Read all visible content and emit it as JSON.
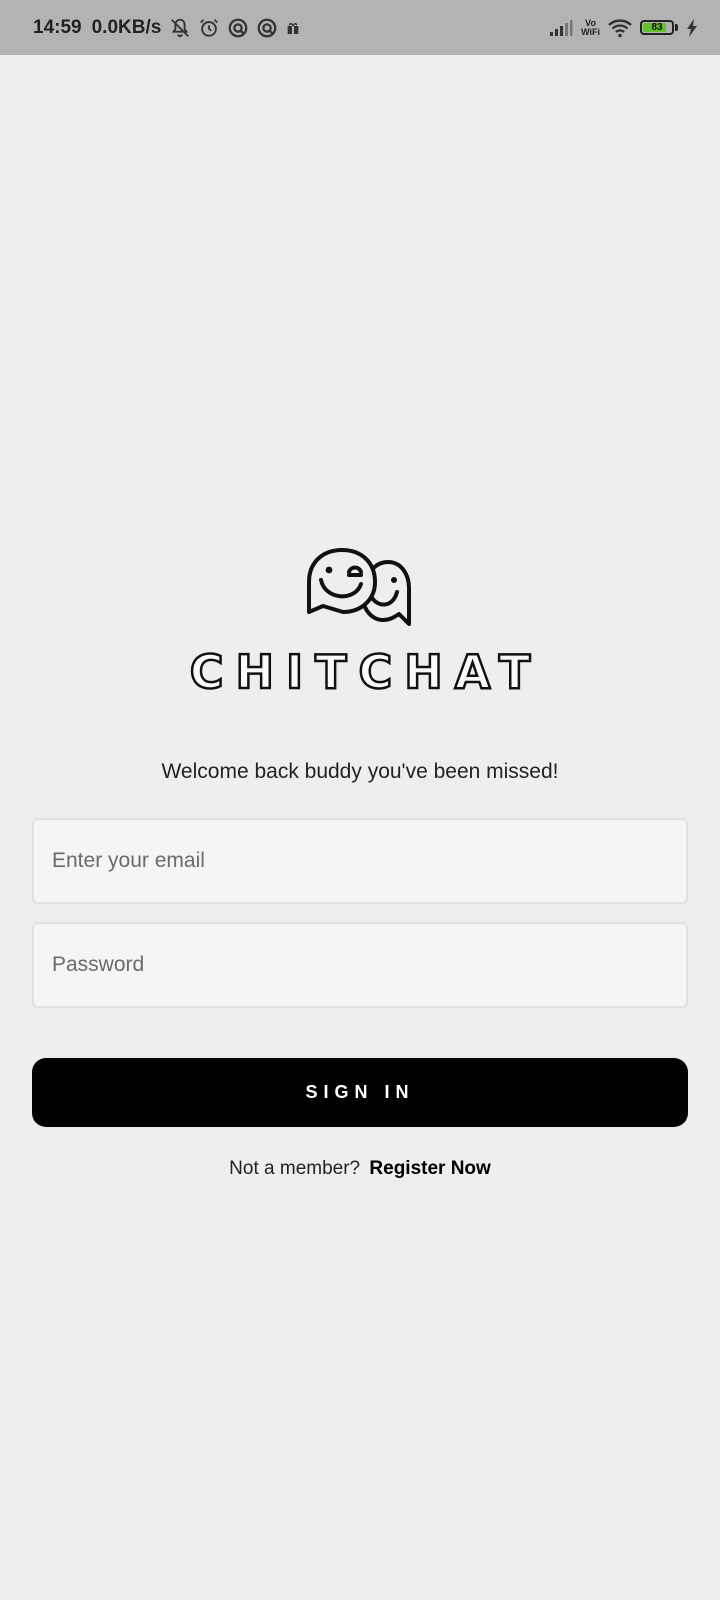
{
  "status_bar": {
    "time": "14:59",
    "net_speed": "0.0KB/s",
    "left_icons": [
      "mute-notifications-icon",
      "alarm-icon",
      "data-saver-icon",
      "data-saver-icon",
      "gift-icon"
    ],
    "right_icons": [
      "signal-icon",
      "vowifi-icon",
      "wifi-icon",
      "battery-icon",
      "charging-icon"
    ],
    "vowifi_top": "Vo",
    "vowifi_bottom": "WiFi",
    "battery_level": "83",
    "battery_fill_fraction": 0.83,
    "battery_color": "#66c22b"
  },
  "logo": {
    "icon": "chat-bubbles-smiley-icon",
    "brand_name": "CHITCHAT"
  },
  "welcome_text": "Welcome back buddy you've been missed!",
  "form": {
    "email": {
      "placeholder": "Enter your email",
      "value": ""
    },
    "password": {
      "placeholder": "Password",
      "value": ""
    },
    "signin_label": "SIGN IN"
  },
  "register": {
    "prompt": "Not a member?",
    "link_label": "Register Now"
  },
  "colors": {
    "background": "#eeeeee",
    "status_bar": "#b3b3b3",
    "button": "#000000",
    "field_background": "#f5f5f5"
  }
}
